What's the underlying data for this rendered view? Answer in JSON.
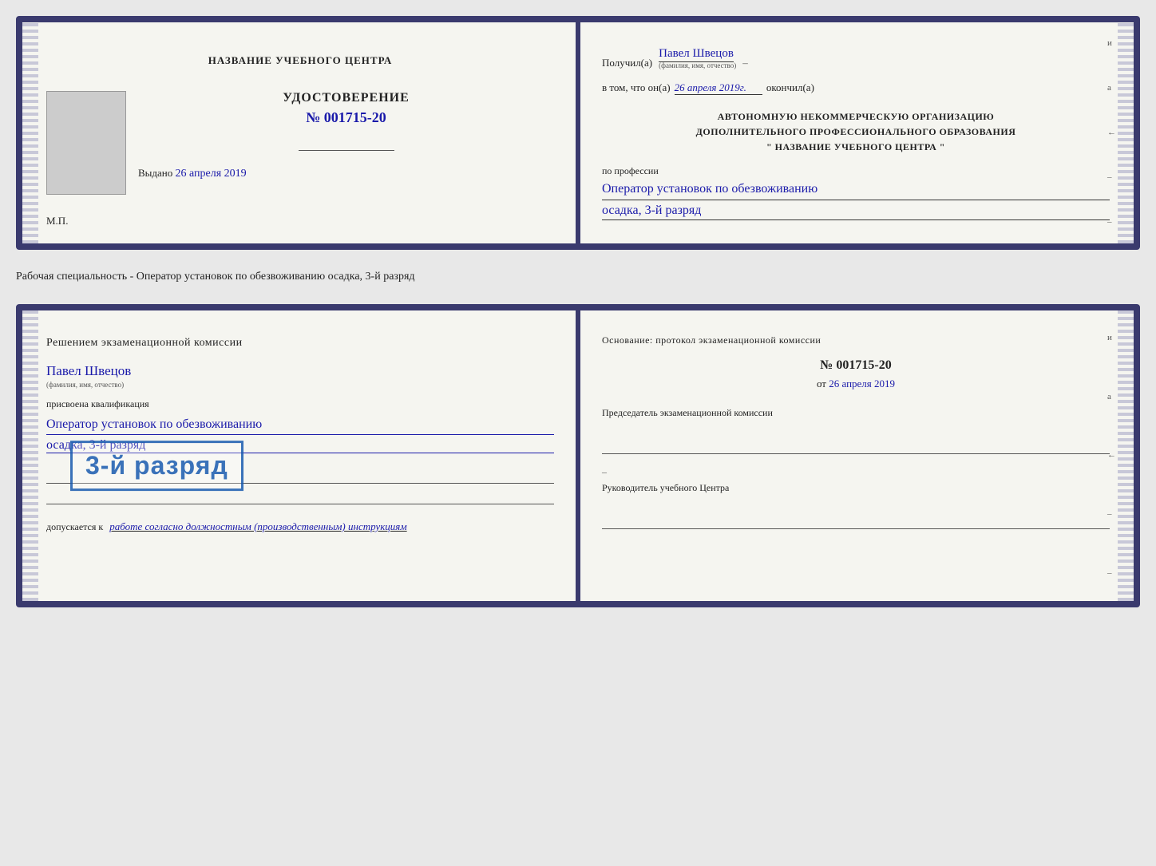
{
  "doc1": {
    "left": {
      "center_title": "НАЗВАНИЕ УЧЕБНОГО ЦЕНТРА",
      "cert_label": "УДОСТОВЕРЕНИЕ",
      "cert_number": "№ 001715-20",
      "issued_label": "Выдано",
      "issued_date": "26 апреля 2019",
      "mp_label": "М.П."
    },
    "right": {
      "received_label": "Получил(а)",
      "person_name": "Павел Швецов",
      "fio_sub": "(фамилия, имя, отчество)",
      "dash": "–",
      "date_prefix": "в том, что он(а)",
      "date_value": "26 апреля 2019г.",
      "finished_label": "окончил(а)",
      "org_line1": "АВТОНОМНУЮ НЕКОММЕРЧЕСКУЮ ОРГАНИЗАЦИЮ",
      "org_line2": "ДОПОЛНИТЕЛЬНОГО ПРОФЕССИОНАЛЬНОГО ОБРАЗОВАНИЯ",
      "org_line3": "\"    НАЗВАНИЕ УЧЕБНОГО ЦЕНТРА    \"",
      "profession_label": "по профессии",
      "profession_value": "Оператор установок по обезвоживанию",
      "rank_value": "осадка, 3-й разряд",
      "side_chars": [
        "и",
        "а",
        "←",
        "–",
        "–"
      ]
    }
  },
  "middle_text": "Рабочая специальность - Оператор установок по обезвоживанию осадка, 3-й разряд",
  "doc2": {
    "left": {
      "commission_title": "Решением экзаменационной комиссии",
      "person_name": "Павел Швецов",
      "fio_sub": "(фамилия, имя, отчество)",
      "qualified_label": "присвоена квалификация",
      "profession_value": "Оператор установок по обезвоживанию",
      "rank_value": "осадка, 3-й разряд",
      "допускается_label": "допускается к",
      "допускается_value": "работе согласно должностным (производственным) инструкциям",
      "side_chars": [
        "и",
        "а",
        "←",
        "–",
        "–"
      ]
    },
    "right": {
      "osnov_label": "Основание: протокол экзаменационной комиссии",
      "cert_number": "№  001715-20",
      "date_prefix": "от",
      "date_value": "26 апреля 2019",
      "chairman_label": "Председатель экзаменационной комиссии",
      "director_label": "Руководитель учебного Центра",
      "dash1": "–",
      "dash2": "–",
      "dash3": "–"
    },
    "stamp": {
      "text": "3-й разряд"
    }
  }
}
